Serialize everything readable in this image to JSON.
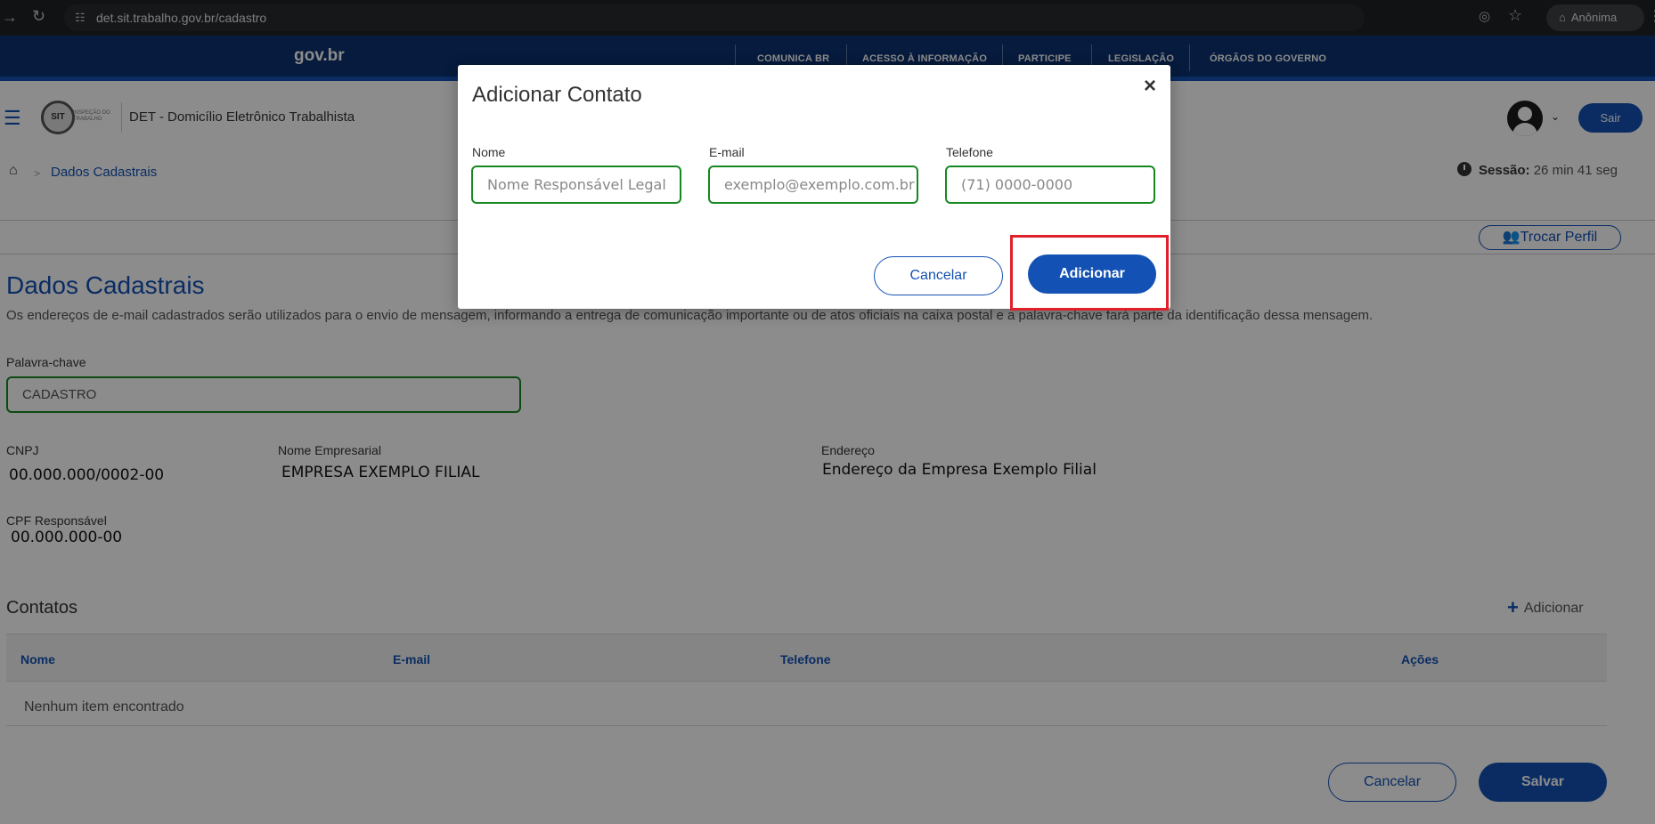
{
  "browser": {
    "url": "det.sit.trabalho.gov.br/cadastro",
    "profile": "Anônima",
    "icons": [
      "back-arrow-icon",
      "reload-icon",
      "site-settings-icon",
      "eye-off-icon",
      "star-icon",
      "incognito-icon",
      "more-icon"
    ]
  },
  "gov_bar": {
    "logo": "gov.br",
    "links": [
      "COMUNICA BR",
      "ACESSO À INFORMAÇÃO",
      "PARTICIPE",
      "LEGISLAÇÃO",
      "ÓRGÃOS DO GOVERNO"
    ]
  },
  "header": {
    "logo_text": "SIT",
    "logo_small": "INSPEÇÃO DO TRABALHO",
    "app_title": "DET - Domicílio Eletrônico Trabalhista",
    "logout_label": "Sair"
  },
  "breadcrumb": {
    "current": "Dados Cadastrais"
  },
  "session": {
    "label": "Sessão:",
    "time": "26 min 41 seg"
  },
  "switch_profile_label": "Trocar Perfil",
  "main": {
    "title": "Dados Cadastrais",
    "description": "Os endereços de e-mail cadastrados serão utilizados para o envio de mensagem, informando a entrega de comunicação importante ou de atos oficiais na caixa postal e a palavra-chave fará parte da identificação dessa mensagem.",
    "keyword": {
      "label": "Palavra-chave",
      "value": "CADASTRO"
    },
    "cnpj": {
      "label": "CNPJ",
      "value": "00.000.000/0002-00"
    },
    "company_name": {
      "label": "Nome Empresarial",
      "value": "EMPRESA EXEMPLO FILIAL"
    },
    "address": {
      "label": "Endereço",
      "value": "Endereço da Empresa Exemplo Filial"
    },
    "cpf": {
      "label": "CPF Responsável",
      "value": "00.000.000-00"
    },
    "contacts": {
      "title": "Contatos",
      "add_label": "Adicionar",
      "columns": [
        "Nome",
        "E-mail",
        "Telefone",
        "Ações"
      ],
      "empty_text": "Nenhum item encontrado"
    },
    "cancel_label": "Cancelar",
    "save_label": "Salvar"
  },
  "modal": {
    "title": "Adicionar Contato",
    "close_glyph": "×",
    "name": {
      "label": "Nome",
      "value": "Nome Responsável Legal"
    },
    "email": {
      "label": "E-mail",
      "placeholder": "exemplo@exemplo.com.br"
    },
    "phone": {
      "label": "Telefone",
      "placeholder": "(71) 0000-0000"
    },
    "cancel_label": "Cancelar",
    "add_label": "Adicionar"
  },
  "colors": {
    "primary": "#1351b4",
    "gov_bar": "#0c326f",
    "valid_border": "#168821",
    "highlight": "#e0202a"
  }
}
